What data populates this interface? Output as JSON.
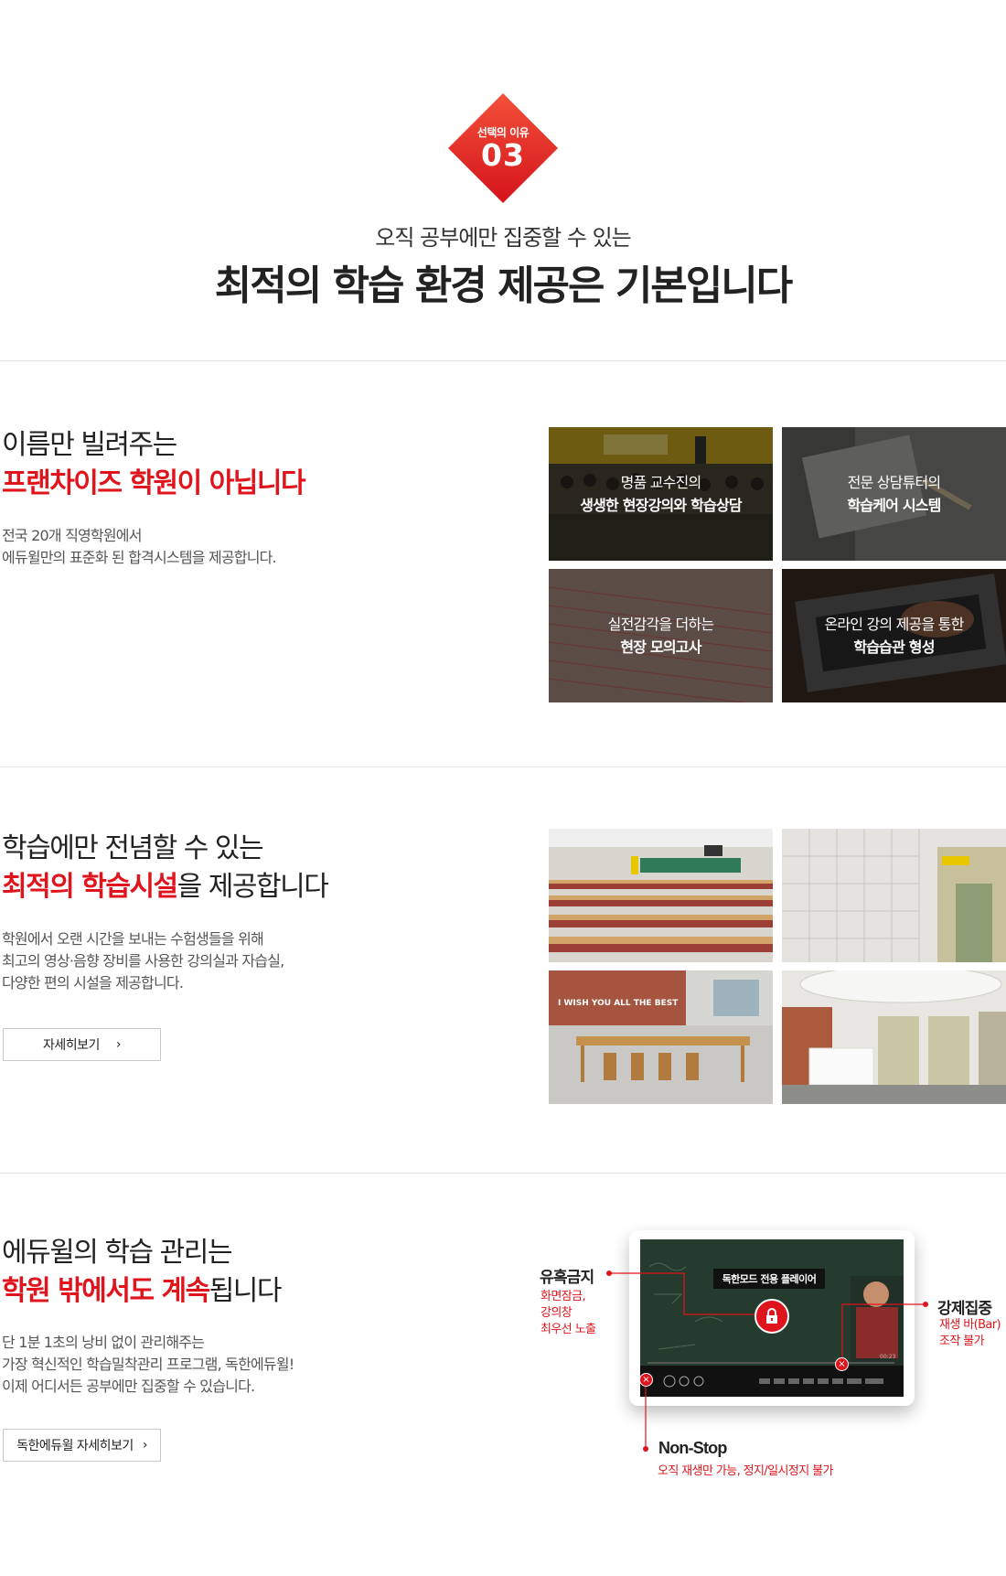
{
  "hero": {
    "badge_sub": "선택의 이유",
    "badge_num": "03",
    "subtitle": "오직 공부에만 집중할 수 있는",
    "title": "최적의 학습 환경 제공은 기본입니다"
  },
  "section1": {
    "line1": "이름만 빌려주는",
    "line2": "프랜차이즈 학원이 아닙니다",
    "desc": [
      "전국 20개 직영학원에서",
      "에듀윌만의 표준화 된 합격시스템을 제공합니다."
    ],
    "tiles": [
      {
        "top": "명품 교수진의",
        "bottom": "생생한 현장강의와 학습상담"
      },
      {
        "top": "전문 상담튜터의",
        "bottom": "학습케어 시스템"
      },
      {
        "top": "실전감각을 더하는",
        "bottom": "현장 모의고사"
      },
      {
        "top": "온라인 강의 제공을 통한",
        "bottom": "학습습관 형성"
      }
    ]
  },
  "section2": {
    "line1": "학습에만 전념할 수 있는",
    "line2_red": "최적의 학습시설",
    "line2_rest": "을 제공합니다",
    "desc": [
      "학원에서 오랜 시간을 보내는 수험생들을 위해",
      "최고의 영상·음향 장비를 사용한 강의실과 자습실,",
      "다양한 편의 시설을 제공합니다."
    ],
    "button": "자세히보기",
    "photo_wall_text": "I WISH YOU ALL THE BEST"
  },
  "section3": {
    "line1": "에듀윌의 학습 관리는",
    "line2_red": "학원 밖에서도 계속",
    "line2_rest": "됩니다",
    "desc": [
      "단 1분 1초의 낭비 없이 관리해주는",
      "가장 혁신적인 학습밀착관리 프로그램, 독한에듀윌!",
      "이제 어디서든 공부에만 집중할 수 있습니다."
    ],
    "button": "독한에듀윌 자세히보기",
    "player_title": "독한모드 전용 플레이어",
    "player_time": "00:23",
    "annotations": {
      "left_title": "유혹금지",
      "left_text": [
        "화면잠금,",
        "강의창",
        "최우선 노출"
      ],
      "right_title": "강제집중",
      "right_text": [
        "재생 바(Bar)",
        "조작 불가"
      ],
      "bottom_title": "Non-Stop",
      "bottom_text": "오직 재생만 가능, 정지/일시정지 불가"
    }
  },
  "colors": {
    "accent": "#e0141d",
    "text": "#222222"
  }
}
